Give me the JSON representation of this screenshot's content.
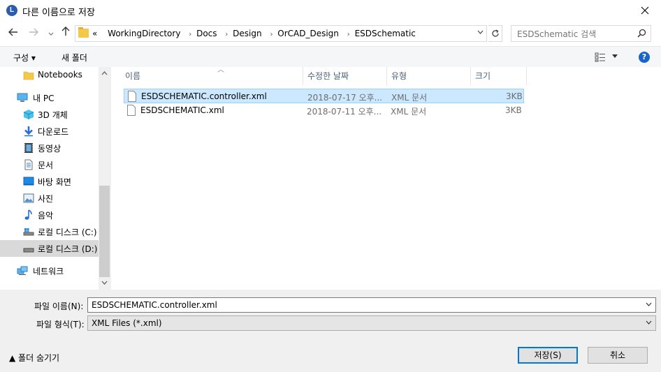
{
  "title": "다른 이름으로 저장",
  "title_icon_letter": "L",
  "address": {
    "overflow": "«",
    "crumbs": [
      "WorkingDirectory",
      "Docs",
      "Design",
      "OrCAD_Design",
      "ESDSchematic"
    ]
  },
  "search": {
    "placeholder": "ESDSchematic 검색"
  },
  "toolbar": {
    "organize": "구성 ▾",
    "new_folder": "새 폴더",
    "help": "?"
  },
  "nav": {
    "items": [
      {
        "label": "Notebooks",
        "icon": "folder-icon"
      },
      {
        "label": "내 PC",
        "icon": "pc-icon"
      },
      {
        "label": "3D 개체",
        "icon": "3d-objects-icon"
      },
      {
        "label": "다운로드",
        "icon": "download-icon"
      },
      {
        "label": "동영상",
        "icon": "video-icon"
      },
      {
        "label": "문서",
        "icon": "document-icon"
      },
      {
        "label": "바탕 화면",
        "icon": "desktop-icon"
      },
      {
        "label": "사진",
        "icon": "picture-icon"
      },
      {
        "label": "음악",
        "icon": "music-icon"
      },
      {
        "label": "로컬 디스크 (C:)",
        "icon": "drive-icon"
      },
      {
        "label": "로컬 디스크 (D:)",
        "icon": "drive-icon"
      },
      {
        "label": "네트워크",
        "icon": "network-icon"
      }
    ],
    "selected_index": 10
  },
  "columns": [
    "이름",
    "수정한 날짜",
    "유형",
    "크기"
  ],
  "files": [
    {
      "name": "ESDSCHEMATIC.controller.xml",
      "date": "2018-07-17 오후...",
      "type": "XML 문서",
      "size": "3KB",
      "selected": true
    },
    {
      "name": "ESDSCHEMATIC.xml",
      "date": "2018-07-11 오후...",
      "type": "XML 문서",
      "size": "3KB",
      "selected": false
    }
  ],
  "filename": {
    "label": "파일 이름(N):",
    "value": "ESDSCHEMATIC.controller.xml"
  },
  "filetype": {
    "label": "파일 형식(T):",
    "value": "XML Files (*.xml)"
  },
  "hide_folders": "▲  폴더 숨기기",
  "buttons": {
    "save": "저장(S)",
    "cancel": "취소"
  },
  "colors": {
    "selection": "#cce8ff",
    "selection_border": "#99d1ff",
    "accent": "#0078d7"
  }
}
